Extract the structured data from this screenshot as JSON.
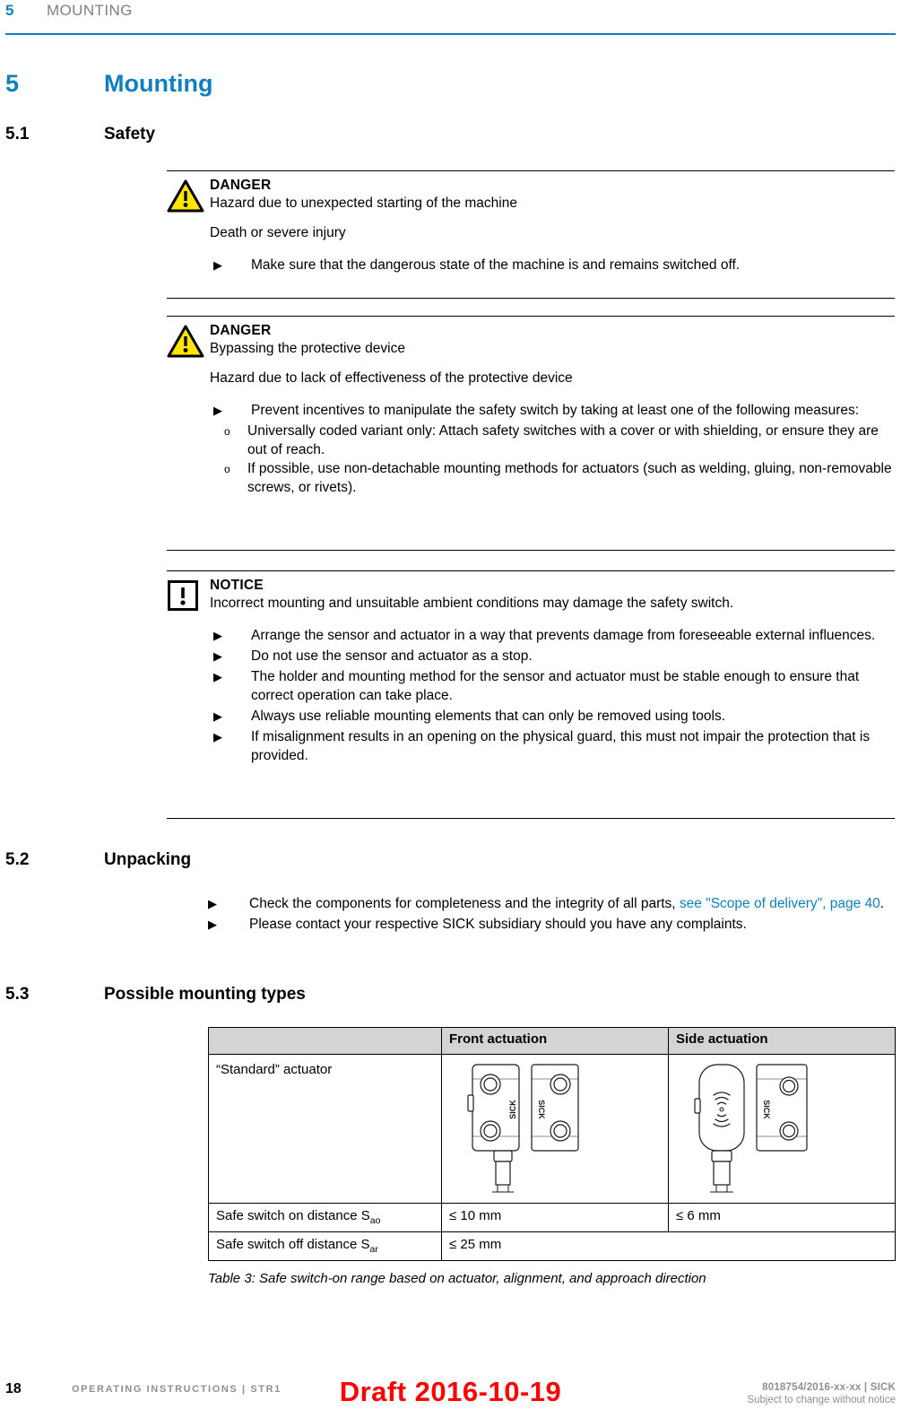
{
  "header": {
    "chapter_number": "5",
    "chapter_title": "MOUNTING",
    "accent_color": "#0f7fc0"
  },
  "headings": {
    "h1_number": "5",
    "h1_title": "Mounting",
    "h2_1_number": "5.1",
    "h2_1_title": "Safety",
    "h2_2_number": "5.2",
    "h2_2_title": "Unpacking",
    "h2_3_number": "5.3",
    "h2_3_title": "Possible mounting types"
  },
  "admonitions": [
    {
      "icon": "warning-triangle-icon",
      "label": "DANGER",
      "subtitle": "Hazard due to unexpected starting of the machine",
      "paragraph": "Death or severe injury",
      "items": [
        {
          "marker": "▶",
          "text": "Make sure that the dangerous state of the machine is and remains switched off."
        }
      ]
    },
    {
      "icon": "warning-triangle-icon",
      "label": "DANGER",
      "subtitle": "Bypassing the protective device",
      "paragraph": "Hazard due to lack of effectiveness of the protective device",
      "items": [
        {
          "marker": "▶",
          "text": "Prevent incentives to manipulate the safety switch by taking at least one of the following measures:",
          "subitems": [
            {
              "marker": "o",
              "text": "Universally coded variant only: Attach safety switches with a cover or with shielding, or ensure they are out of reach."
            },
            {
              "marker": "o",
              "text": "If possible, use non-detachable mounting methods for actuators (such as welding, gluing, non-removable screws, or rivets)."
            }
          ]
        }
      ]
    },
    {
      "icon": "notice-square-icon",
      "label": "NOTICE",
      "subtitle": "Incorrect mounting and unsuitable ambient conditions may damage the safety switch.",
      "paragraph": "",
      "items": [
        {
          "marker": "▶",
          "text": "Arrange the sensor and actuator in a way that prevents damage from foreseeable external influences."
        },
        {
          "marker": "▶",
          "text": "Do not use the sensor and actuator as a stop."
        },
        {
          "marker": "▶",
          "text": "The holder and mounting method for the sensor and actuator must be stable enough to ensure that correct operation can take place."
        },
        {
          "marker": "▶",
          "text": "Always use reliable mounting elements that can only be removed using tools."
        },
        {
          "marker": "▶",
          "text": "If misalignment results in an opening on the physical guard, this must not impair the protection that is provided."
        }
      ]
    }
  ],
  "unpacking": {
    "items": [
      {
        "marker": "▶",
        "text_before": "Check the components for completeness and the integrity of all parts, ",
        "link_text": "see \"Scope of delivery\", page 40",
        "text_after": ".",
        "link_color": "#0f7fc0"
      },
      {
        "marker": "▶",
        "text_before": "Please contact your respective SICK subsidiary should you have any complaints.",
        "link_text": "",
        "text_after": ""
      }
    ]
  },
  "table": {
    "header_bg": "#d4d4d4",
    "columns": [
      "",
      "Front actuation",
      "Side actuation"
    ],
    "rows": [
      {
        "label": "“Standard” actuator",
        "front": "front-actuation-illustration",
        "side": "side-actuation-illustration",
        "type": "illustration"
      },
      {
        "label_text": "Safe switch on distance S",
        "label_sub": "ao",
        "front": "≤ 10 mm",
        "side": "≤ 6 mm",
        "type": "text"
      },
      {
        "label_text": "Safe switch off distance S",
        "label_sub": "ar",
        "front": "≤ 25 mm",
        "side": "",
        "type": "text-merged"
      }
    ],
    "caption": "Table 3: Safe switch-on range based on actuator, alignment, and approach direction",
    "device_brand": "SICK"
  },
  "footer": {
    "page_number": "18",
    "left_text": "OPERATING INSTRUCTIONS | STR1",
    "right_line1": "8018754/2016-xx-xx | SICK",
    "right_line2": "Subject to change without notice",
    "watermark": "Draft 2016-10-19",
    "watermark_color": "#ff0000"
  }
}
